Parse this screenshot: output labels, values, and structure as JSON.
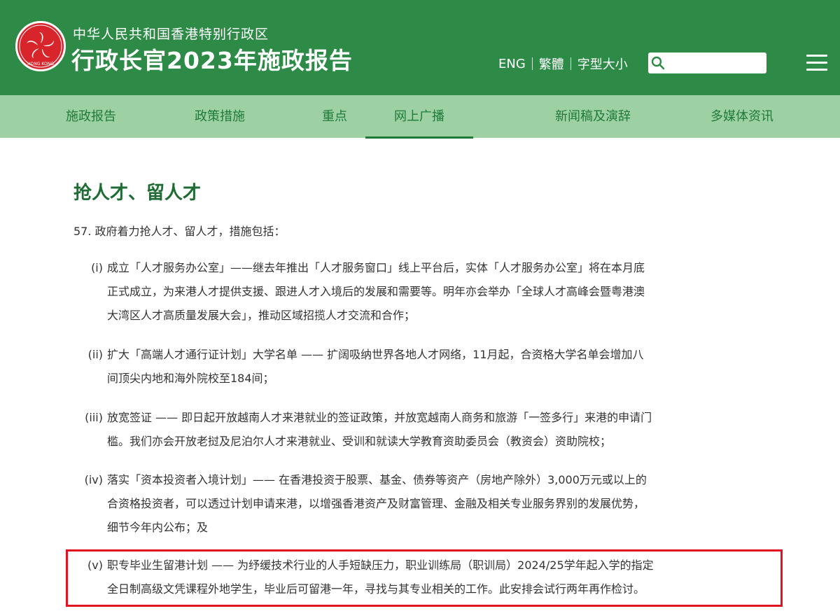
{
  "header": {
    "subtitle": "中华人民共和国香港特别行政区",
    "title": "行政长官2023年施政报告",
    "emblem_icon": "hksar-emblem-icon",
    "emblem_text": "HONG KONG",
    "lang_eng": "ENG",
    "lang_trad": "繁體",
    "font_size": "字型大小",
    "search": {
      "placeholder": "",
      "value": ""
    },
    "menu_icon": "hamburger-menu-icon"
  },
  "nav": {
    "items": [
      {
        "label": "施政报告"
      },
      {
        "label": "政策措施"
      },
      {
        "label": "重点"
      },
      {
        "label": "网上广播"
      },
      {
        "label": "新闻稿及演辞"
      },
      {
        "label": "多媒体资讯"
      }
    ],
    "active_index": 3
  },
  "content": {
    "section_title": "抢人才、留人才",
    "intro": "57. 政府着力抢人才、留人才，措施包括：",
    "items": [
      {
        "num": "(i)",
        "lines": [
          "成立「人才服务办公室」——继去年推出「人才服务窗口」线上平台后，实体「人才服务办公室」将在本月底",
          "正式成立，为来港人才提供支援、跟进人才入境后的发展和需要等。明年亦会举办「全球人才高峰会暨粤港澳",
          "大湾区人才高质量发展大会」，推动区域招揽人才交流和合作；"
        ]
      },
      {
        "num": "(ii)",
        "lines": [
          "扩大「高端人才通行证计划」大学名单 —— 扩阔吸纳世界各地人才网络，11月起，合资格大学名单会增加八",
          "间顶尖内地和海外院校至184间；"
        ]
      },
      {
        "num": "(iii)",
        "lines": [
          "放宽签证 —— 即日起开放越南人才来港就业的签证政策，并放宽越南人商务和旅游「一签多行」来港的申请门",
          "槛。我们亦会开放老挝及尼泊尔人才来港就业、受训和就读大学教育资助委员会（教资会）资助院校；"
        ]
      },
      {
        "num": "(iv)",
        "lines": [
          "落实「资本投资者入境计划」—— 在香港投资于股票、基金、债券等资产（房地产除外）3,000万元或以上的",
          "合资格投资者，可以透过计划申请来港，以增强香港资产及财富管理、金融及相关专业服务界别的发展优势，",
          "细节今年内公布；及"
        ]
      },
      {
        "num": "(v)",
        "lines": [
          "职专毕业生留港计划 —— 为纾缓技术行业的人手短缺压力，职业训练局（职训局）2024/25学年起入学的指定",
          "全日制高级文凭课程外地学生，毕业后可留港一年，寻找与其专业相关的工作。此安排会试行两年再作检讨。"
        ]
      }
    ]
  },
  "colors": {
    "header_bg": "#2e8b47",
    "nav_bg": "#9dd1a3",
    "nav_text": "#1f7a3a",
    "title_green": "#1e6b34",
    "highlight_red": "#e0141e"
  }
}
